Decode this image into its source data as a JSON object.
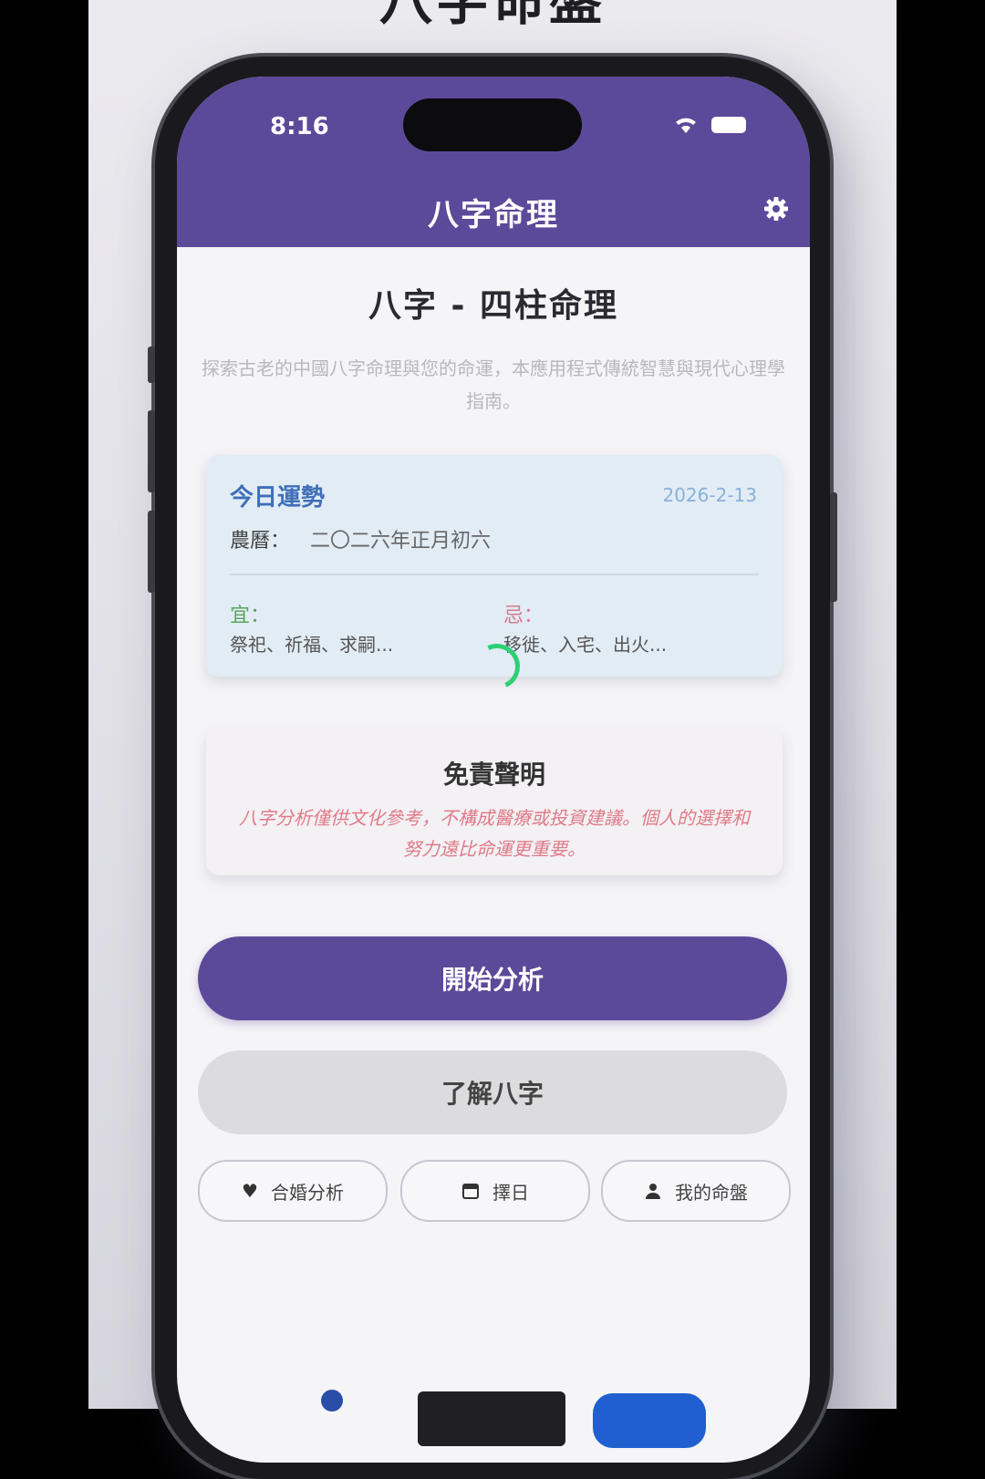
{
  "header": {
    "heading": "八字命盤"
  },
  "status_bar": {
    "time": "8:16"
  },
  "app_bar": {
    "title": "八字命理",
    "settings_icon": "gear-icon"
  },
  "intro": {
    "title": "八字 - 四柱命理",
    "subtitle": "探索古老的中國八字命理與您的命運，本應用程式傳統智慧與現代心理學指南。"
  },
  "fortune_card": {
    "title": "今日運勢",
    "date": "2026-2-13",
    "lunar_label": "農曆：",
    "lunar_value": "二〇二六年正月初六",
    "yi_label": "宜：",
    "yi_value": "祭祀、祈福、求嗣...",
    "ji_label": "忌：",
    "ji_value": "移徙、入宅、出火..."
  },
  "disclaimer": {
    "title": "免責聲明",
    "body": "八字分析僅供文化參考，不構成醫療或投資建議。個人的選擇和努力遠比命運更重要。"
  },
  "actions": {
    "primary_label": "開始分析",
    "secondary_label": "了解八字"
  },
  "chips": [
    {
      "icon": "heart-icon",
      "label": "合婚分析"
    },
    {
      "icon": "calendar-icon",
      "label": "擇日"
    },
    {
      "icon": "person-icon",
      "label": "我的命盤"
    }
  ],
  "colors": {
    "brand": "#5b4a9a",
    "card_blue": "#e1ecf5",
    "yi_green": "#5aa35e",
    "ji_pink": "#d87a8f",
    "spinner_green": "#2fcf74"
  }
}
